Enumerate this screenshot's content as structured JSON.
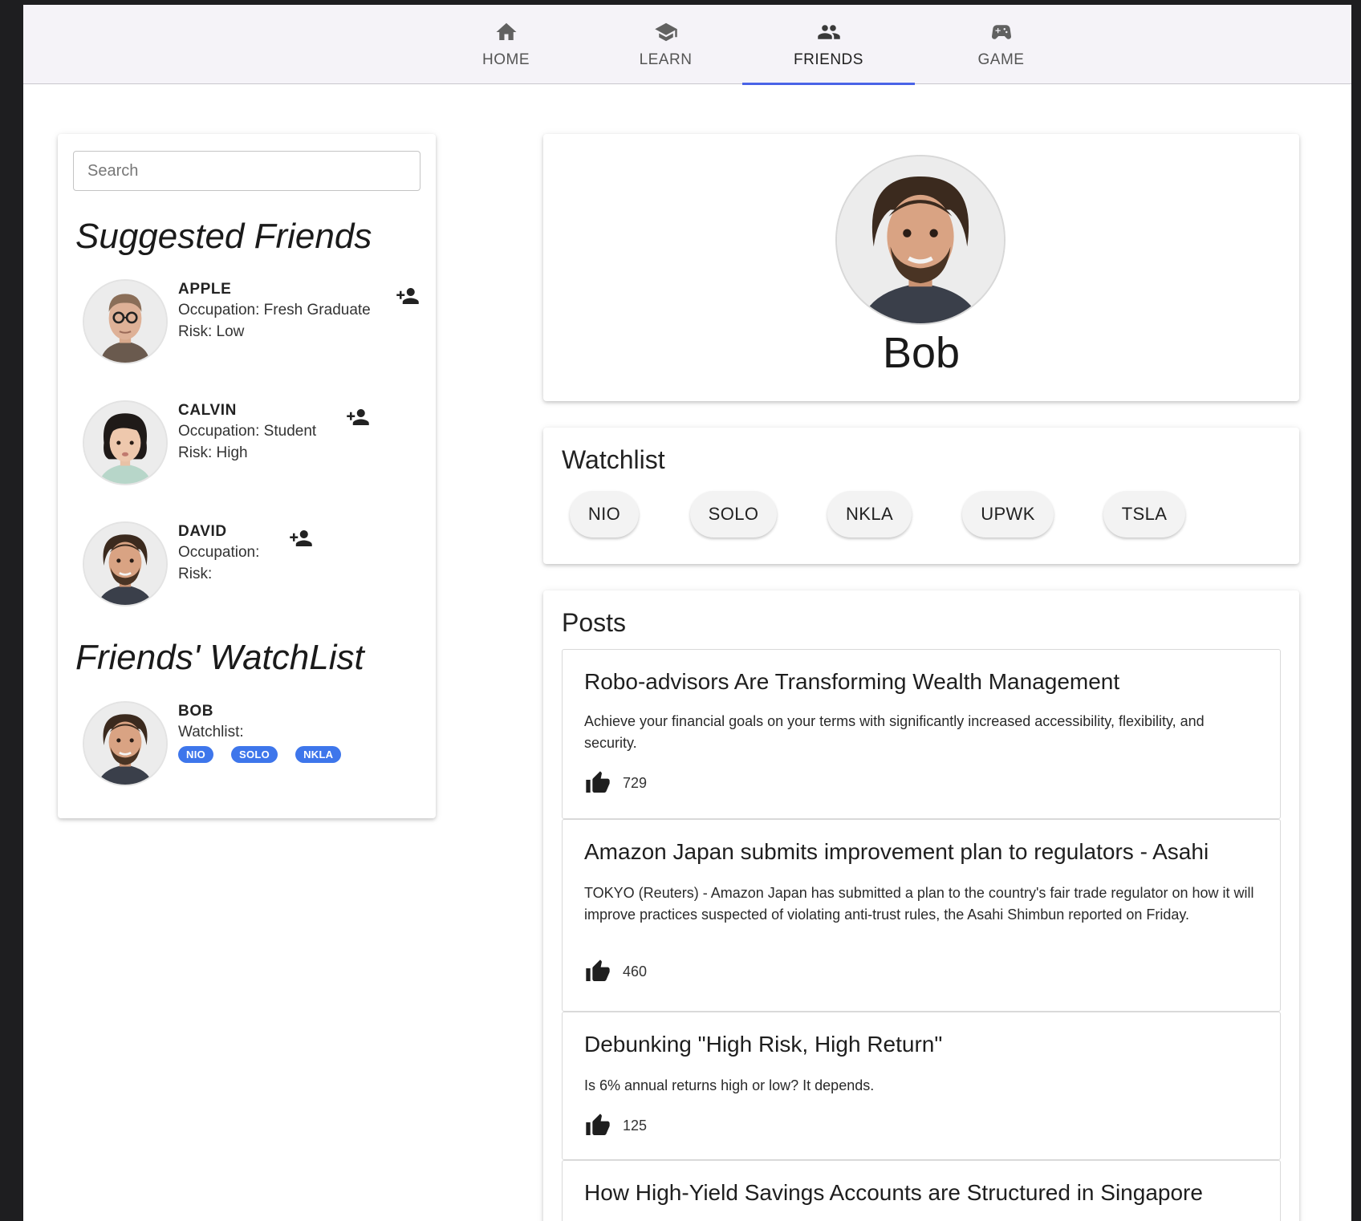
{
  "nav": {
    "tabs": [
      {
        "label": "HOME",
        "icon": "home-icon"
      },
      {
        "label": "LEARN",
        "icon": "school-icon"
      },
      {
        "label": "FRIENDS",
        "icon": "people-icon",
        "active": true
      },
      {
        "label": "GAME",
        "icon": "gamepad-icon"
      }
    ],
    "accent_color": "#4a63e7"
  },
  "sidebar": {
    "search_placeholder": "Search",
    "suggested_title": "Suggested Friends",
    "suggested": [
      {
        "name": "APPLE",
        "occupation": "Occupation: Fresh Graduate",
        "risk": "Risk: Low"
      },
      {
        "name": "CALVIN",
        "occupation": "Occupation: Student",
        "risk": "Risk: High"
      },
      {
        "name": "DAVID",
        "occupation": "Occupation:",
        "risk": "Risk:"
      }
    ],
    "watchlist_title": "Friends' WatchList",
    "friends_watchlist": [
      {
        "name": "BOB",
        "label": "Watchlist:",
        "tickers": [
          "NIO",
          "SOLO",
          "NKLA"
        ]
      }
    ],
    "chip_color": "#3e76eb"
  },
  "profile": {
    "name": "Bob"
  },
  "watchlist": {
    "title": "Watchlist",
    "tickers": [
      "NIO",
      "SOLO",
      "NKLA",
      "UPWK",
      "TSLA"
    ]
  },
  "posts": {
    "title": "Posts",
    "items": [
      {
        "title": "Robo-advisors Are Transforming Wealth Management",
        "body": "Achieve your financial goals on your terms with significantly increased accessibility, flexibility, and security.",
        "likes": "729"
      },
      {
        "title": "Amazon Japan submits improvement plan to regulators - Asahi",
        "body": "TOKYO (Reuters) - Amazon Japan has submitted a plan to the country's fair trade regulator on how it will improve practices suspected of violating anti-trust rules, the Asahi Shimbun reported on Friday.",
        "likes": "460"
      },
      {
        "title": "Debunking \"High Risk, High Return\"",
        "body": "Is 6% annual returns high or low? It depends.",
        "likes": "125"
      },
      {
        "title": "How High-Yield Savings Accounts are Structured in Singapore",
        "body": "",
        "likes": ""
      }
    ]
  }
}
